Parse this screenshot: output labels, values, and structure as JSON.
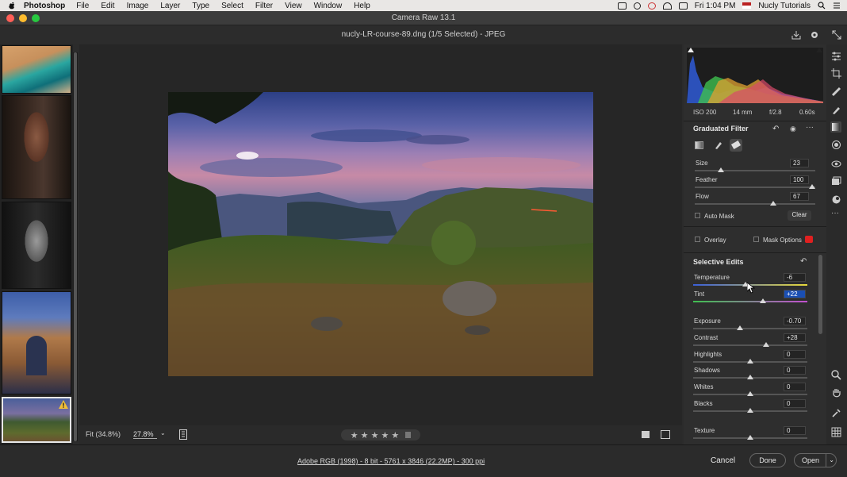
{
  "menubar": {
    "app": "Photoshop",
    "items": [
      "File",
      "Edit",
      "Image",
      "Layer",
      "Type",
      "Select",
      "Filter",
      "View",
      "Window",
      "Help"
    ],
    "clock": "Fri 1:04 PM",
    "user": "Nucly Tutorials"
  },
  "window": {
    "title": "Camera Raw 13.1"
  },
  "document": {
    "name": "nucly-LR-course-89.dng (1/5 Selected)  -  JPEG"
  },
  "bottombar": {
    "fit": "Fit (34.8%)",
    "zoom": "27.8%",
    "stars": "★ ★ ★ ★ ★"
  },
  "footer": {
    "info": "Adobe RGB (1998) - 8 bit - 5761 x 3846 (22.2MP) - 300 ppi",
    "cancel": "Cancel",
    "done": "Done",
    "open": "Open"
  },
  "exif": {
    "iso": "ISO 200",
    "focal": "14 mm",
    "aperture": "f/2.8",
    "shutter": "0.60s"
  },
  "graduated_filter": {
    "title": "Graduated Filter",
    "size_label": "Size",
    "size": "23",
    "feather_label": "Feather",
    "feather": "100",
    "flow_label": "Flow",
    "flow": "67",
    "auto_mask": "Auto Mask",
    "clear": "Clear",
    "overlay": "Overlay",
    "mask_options": "Mask Options",
    "mask_color": "#e02020"
  },
  "selective": {
    "title": "Selective Edits",
    "sliders": [
      {
        "label": "Temperature",
        "value": "-6",
        "pos": 0.46
      },
      {
        "label": "Tint",
        "value": "+22",
        "pos": 0.61
      },
      {
        "label": "Exposure",
        "value": "-0.70",
        "pos": 0.41
      },
      {
        "label": "Contrast",
        "value": "+28",
        "pos": 0.64
      },
      {
        "label": "Highlights",
        "value": "0",
        "pos": 0.5
      },
      {
        "label": "Shadows",
        "value": "0",
        "pos": 0.5
      },
      {
        "label": "Whites",
        "value": "0",
        "pos": 0.5
      },
      {
        "label": "Blacks",
        "value": "0",
        "pos": 0.5
      },
      {
        "label": "Texture",
        "value": "0",
        "pos": 0.5
      }
    ]
  },
  "colors": {
    "accent": "#1a4fb4",
    "warning": "#f2c037"
  }
}
